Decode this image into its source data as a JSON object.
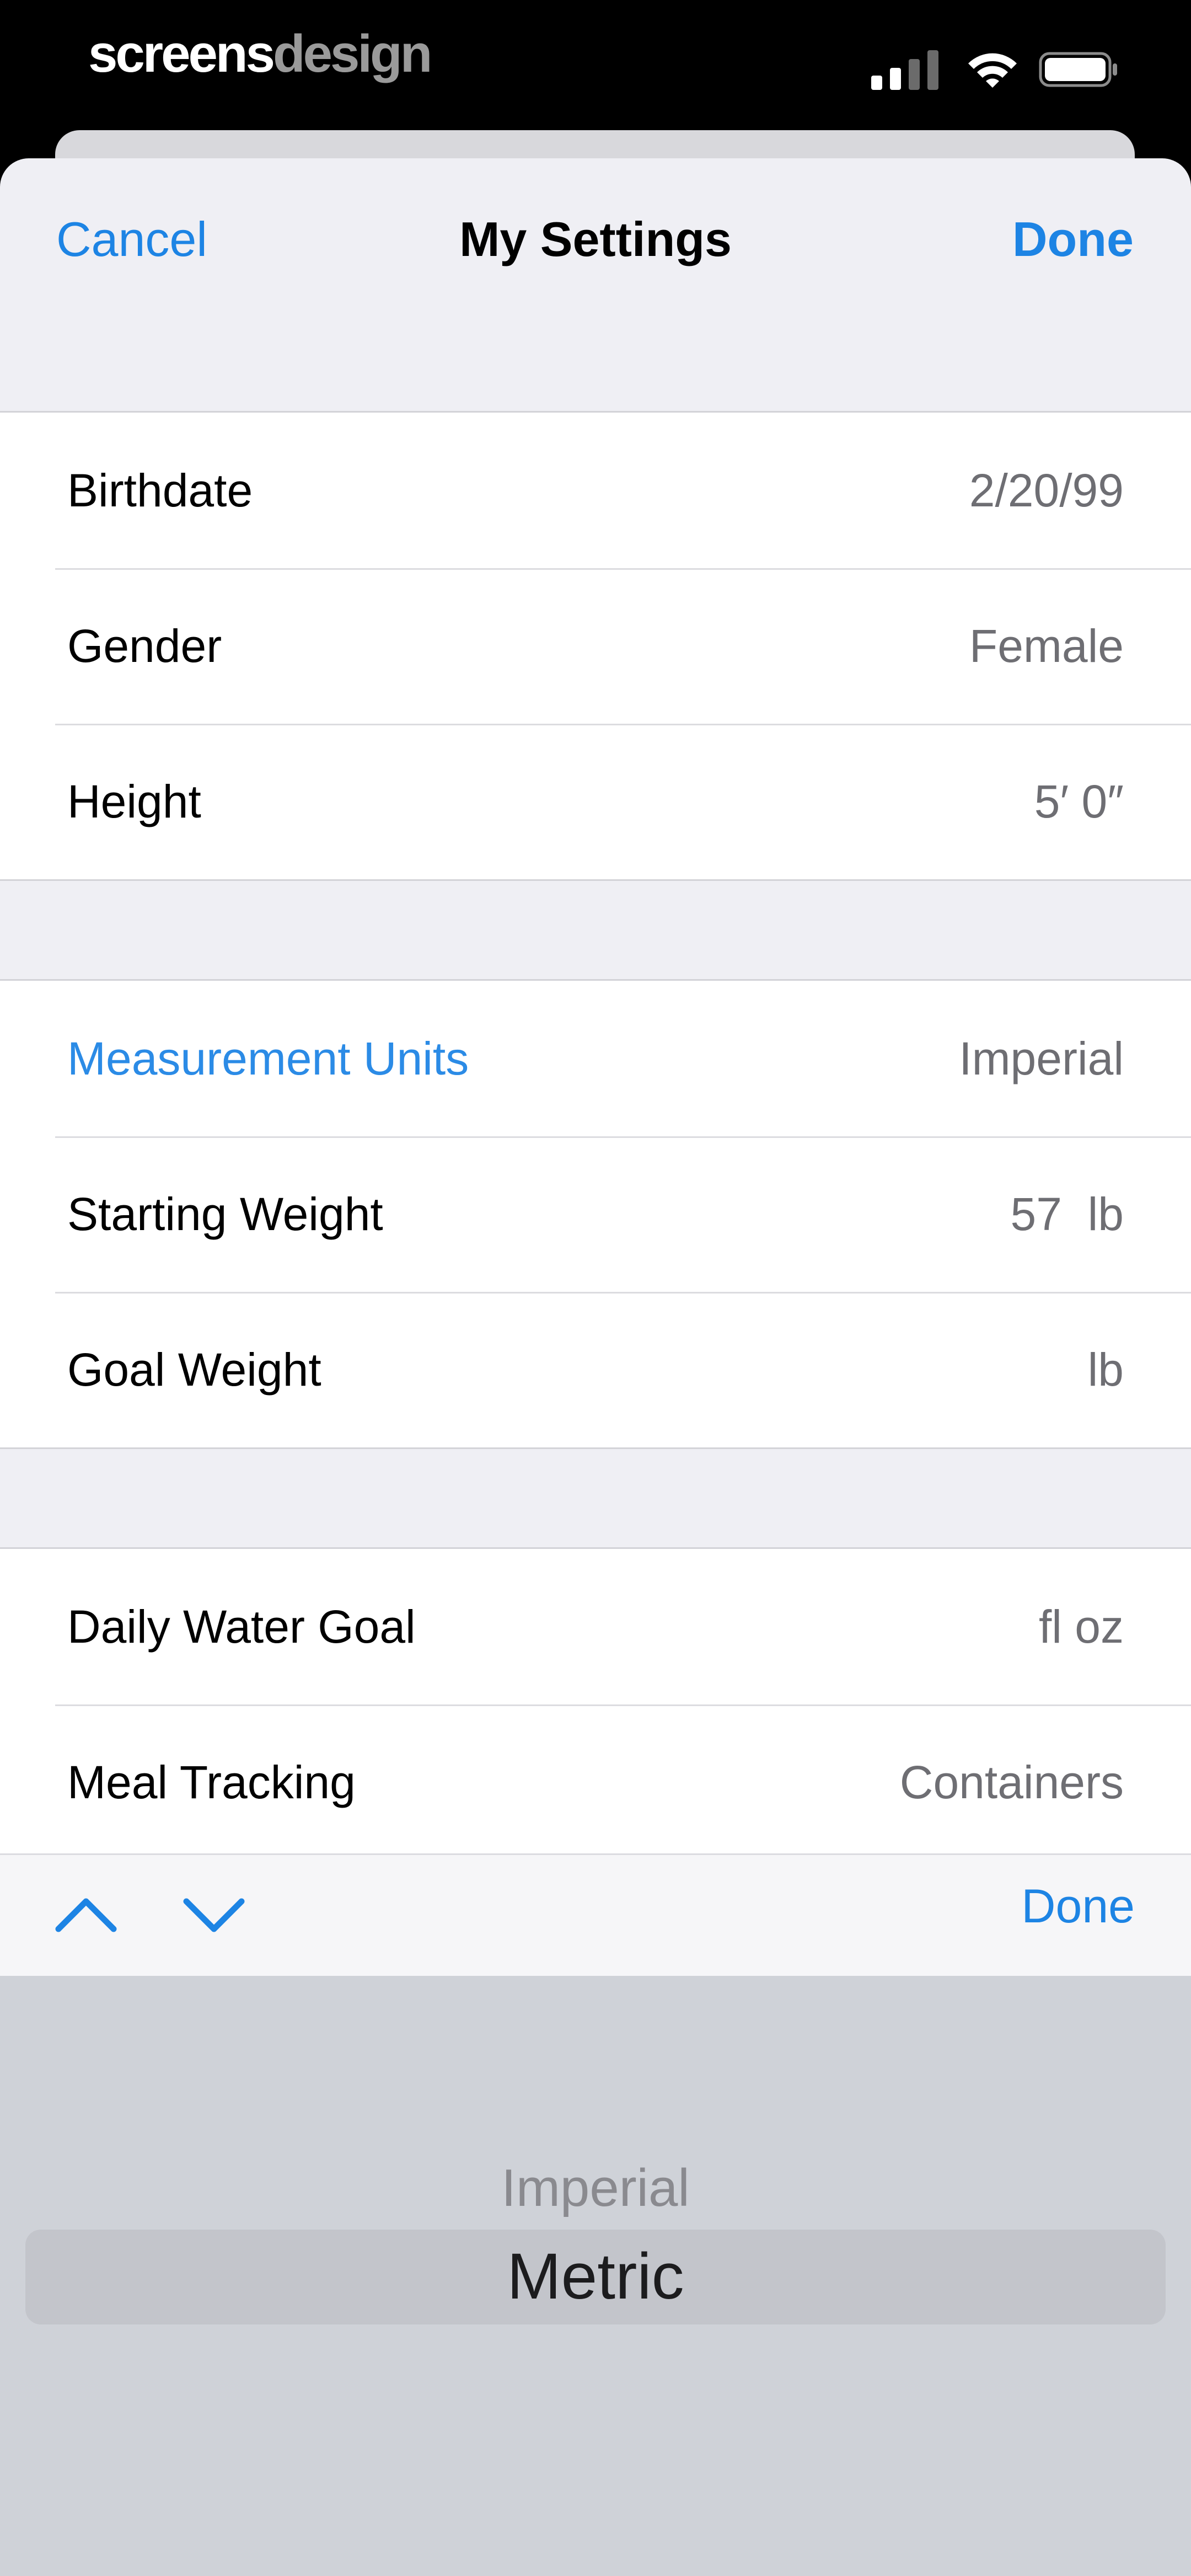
{
  "status_bar": {
    "brand_part1": "screens",
    "brand_part2": "design",
    "icons": [
      "signal-icon",
      "wifi-icon",
      "battery-icon"
    ]
  },
  "nav": {
    "cancel_label": "Cancel",
    "title": "My Settings",
    "done_label": "Done"
  },
  "groups": {
    "personal": [
      {
        "label": "Birthdate",
        "value": "2/20/99"
      },
      {
        "label": "Gender",
        "value": "Female"
      },
      {
        "label": "Height",
        "value": "5′ 0″"
      }
    ],
    "weight": [
      {
        "label": "Measurement Units",
        "value": "Imperial"
      },
      {
        "label": "Starting Weight",
        "value": "57  lb"
      },
      {
        "label": "Goal Weight",
        "value": "lb"
      }
    ],
    "tracking": [
      {
        "label": "Daily Water Goal",
        "value": "fl oz"
      },
      {
        "label": "Meal Tracking",
        "value": "Containers"
      }
    ]
  },
  "accessory": {
    "up_icon": "chevron-up-icon",
    "down_icon": "chevron-down-icon",
    "done_label": "Done"
  },
  "picker": {
    "options": [
      "Imperial",
      "Metric"
    ],
    "selected": "Metric"
  },
  "colors": {
    "accent": "#1d84e4",
    "background": "#efeff4",
    "picker_bg": "#cfd2d8"
  }
}
